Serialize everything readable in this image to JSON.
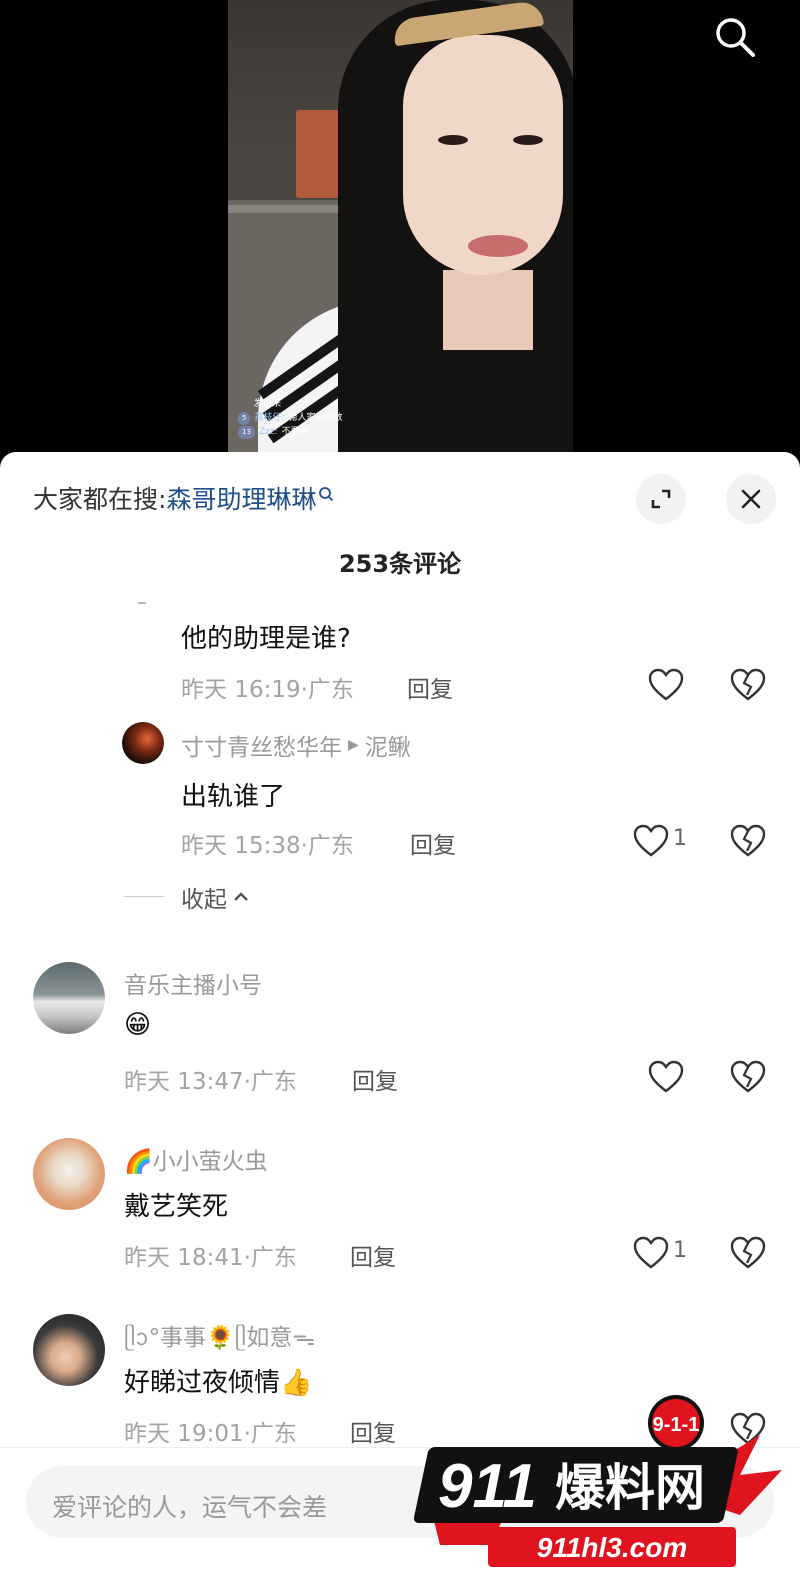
{
  "video": {
    "chat": [
      {
        "badge": "",
        "nick": "",
        "text": "发出来"
      },
      {
        "badge": "5",
        "nick": "荔枝仔:",
        "text": "稳人家男对数"
      },
      {
        "badge": "13",
        "nick": "Zzz:",
        "text": "不要哭"
      }
    ]
  },
  "sheet": {
    "hot_search_prefix": "大家都在搜:",
    "hot_search_term": "森哥助理琳琳",
    "comment_count_title": "253条评论",
    "collapse_label": "收起"
  },
  "replies": [
    {
      "text": "他的助理是谁?",
      "time": "昨天 16:19·广东",
      "reply_label": "回复",
      "likes": ""
    },
    {
      "user": "寸寸青丝愁华年",
      "reply_to": "泥鳅",
      "text": "出轨谁了",
      "time": "昨天 15:38·广东",
      "reply_label": "回复",
      "likes": "1"
    }
  ],
  "comments": [
    {
      "user": "音乐主播小号",
      "text": "😁",
      "time": "昨天 13:47·广东",
      "reply_label": "回复",
      "likes": ""
    },
    {
      "user": "🌈小小萤火虫",
      "text": "戴艺笑死",
      "time": "昨天 18:41·广东",
      "reply_label": "回复",
      "likes": "1"
    },
    {
      "user": "ᥫᩣ°事事🌻ᥫ如意ᯓ",
      "text": "好睇过夜倾情👍",
      "time": "昨天 19:01·广东",
      "reply_label": "回复",
      "likes": ""
    }
  ],
  "input": {
    "placeholder": "爱评论的人，运气不会差"
  },
  "watermark": {
    "badge": "9-1-1",
    "brand_num": "911",
    "brand_text": "爆料网",
    "url": "911hl3.com"
  },
  "colors": {
    "accent_blue": "#1f4e8a",
    "watermark_red": "#e0141e"
  }
}
